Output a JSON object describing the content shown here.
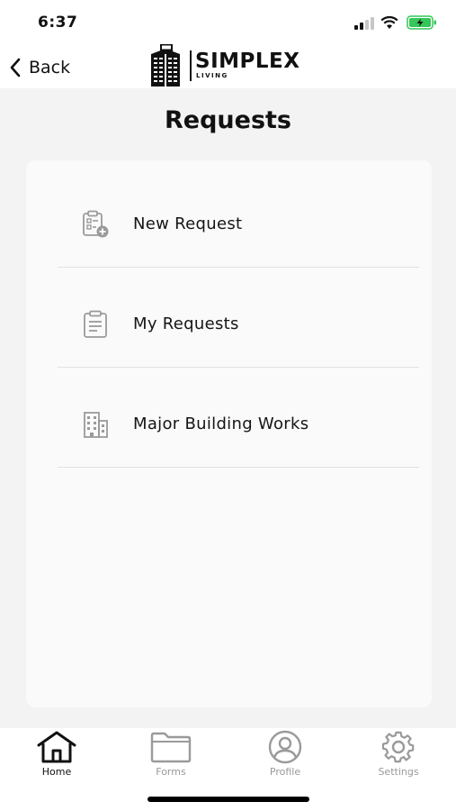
{
  "status": {
    "time": "6:37",
    "battery_color": "#34c759"
  },
  "nav": {
    "back_label": "Back",
    "logo_word": "SIMPLEX",
    "logo_sub": "LIVING"
  },
  "page": {
    "title": "Requests"
  },
  "menu": {
    "items": [
      {
        "label": "New Request",
        "icon": "clipboard-add-icon"
      },
      {
        "label": "My Requests",
        "icon": "clipboard-list-icon"
      },
      {
        "label": "Major Building Works",
        "icon": "building-icon"
      }
    ]
  },
  "tabs": {
    "items": [
      {
        "label": "Home",
        "icon": "home-icon",
        "active": true
      },
      {
        "label": "Forms",
        "icon": "folder-icon",
        "active": false
      },
      {
        "label": "Profile",
        "icon": "profile-icon",
        "active": false
      },
      {
        "label": "Settings",
        "icon": "gear-icon",
        "active": false
      }
    ]
  }
}
